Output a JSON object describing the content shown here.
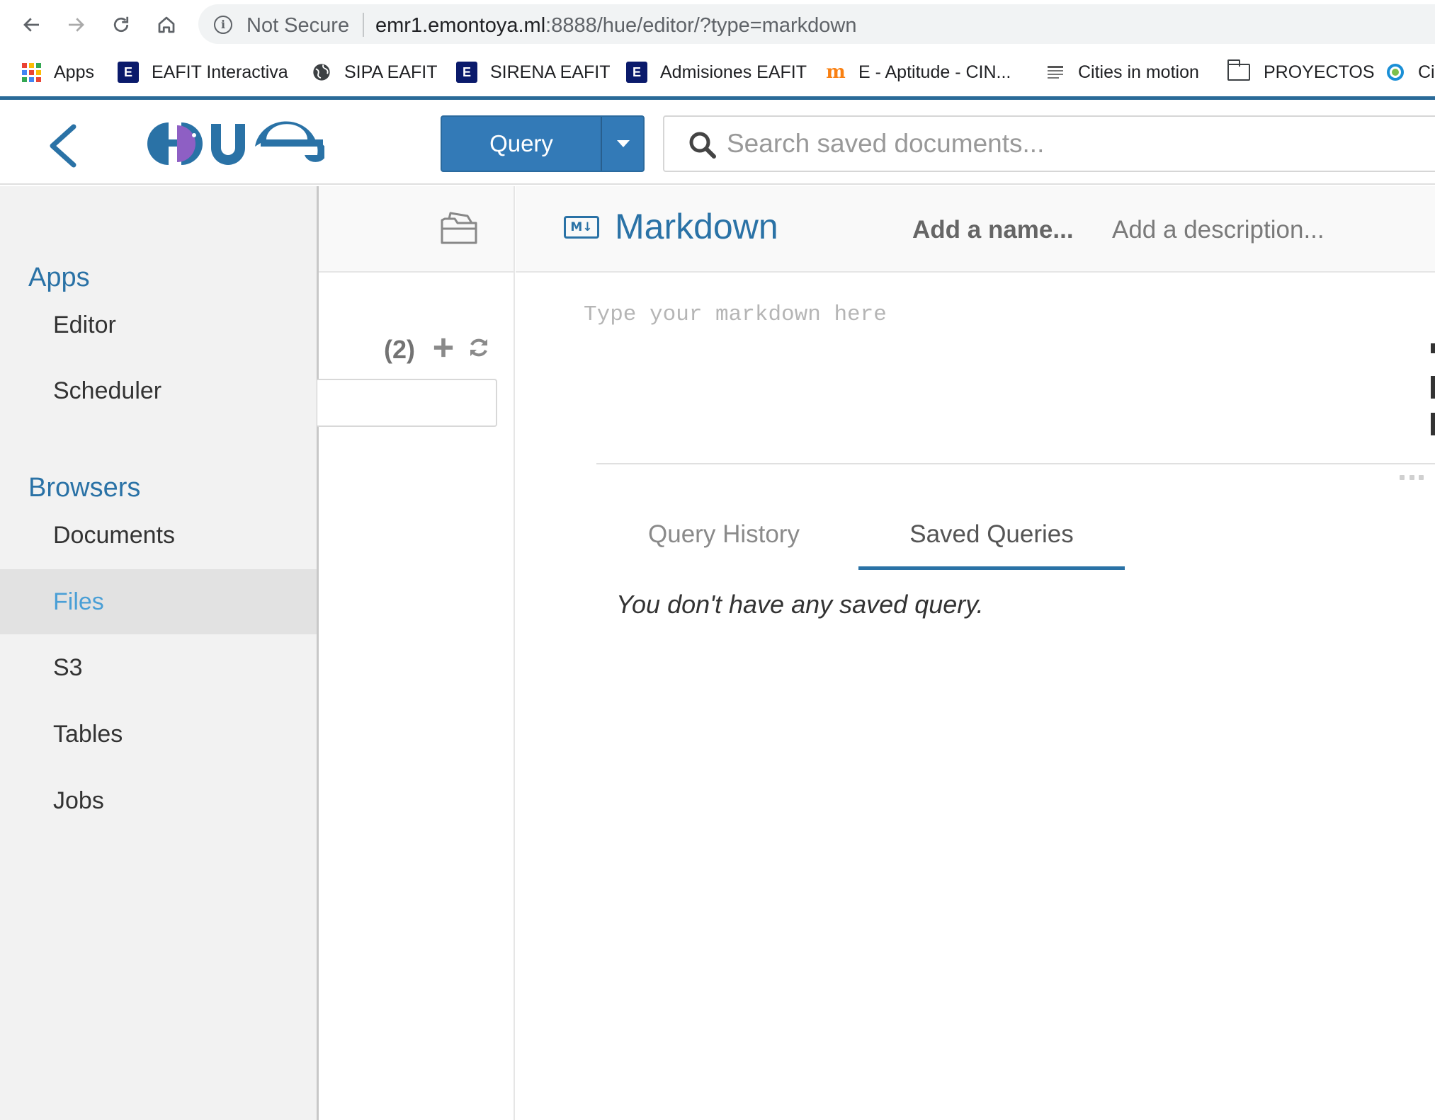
{
  "browser": {
    "security_label": "Not Secure",
    "url_host": "emr1.emontoya.ml",
    "url_rest": ":8888/hue/editor/?type=markdown",
    "bookmarks": [
      {
        "label": "Apps",
        "icon": "apps-grid-icon"
      },
      {
        "label": "EAFIT Interactiva",
        "icon": "eafit-e-icon"
      },
      {
        "label": "SIPA EAFIT",
        "icon": "globe-icon"
      },
      {
        "label": "SIRENA EAFIT",
        "icon": "eafit-e-icon"
      },
      {
        "label": "Admisiones EAFIT",
        "icon": "eafit-e-icon"
      },
      {
        "label": "E - Aptitude - CIN...",
        "icon": "moodle-icon"
      },
      {
        "label": "Cities in motion",
        "icon": "iese-icon"
      },
      {
        "label": "PROYECTOS",
        "icon": "folder-icon"
      },
      {
        "label": "Ci",
        "icon": "circle-app-icon"
      }
    ]
  },
  "hue": {
    "query_button": "Query",
    "search_placeholder": "Search saved documents..."
  },
  "left_nav": {
    "sections": [
      {
        "title": "Apps",
        "items": [
          "Editor",
          "Scheduler"
        ]
      },
      {
        "title": "Browsers",
        "items": [
          "Documents",
          "Files",
          "S3",
          "Tables",
          "Jobs"
        ]
      }
    ],
    "active_item": "Files"
  },
  "assist": {
    "count": "(2)"
  },
  "editor": {
    "type_title": "Markdown",
    "name_placeholder": "Add a name...",
    "description_placeholder": "Add a description...",
    "markdown_placeholder": "Type your markdown here",
    "tabs": [
      "Query History",
      "Saved Queries"
    ],
    "active_tab": "Saved Queries",
    "empty_message": "You don't have any saved query."
  },
  "colors": {
    "hue_blue": "#2a72a6",
    "query_button": "#337ab7",
    "active_nav_text": "#4a9fd6"
  }
}
